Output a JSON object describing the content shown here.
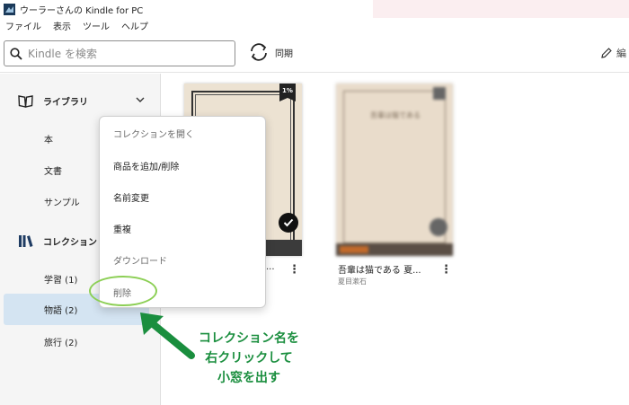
{
  "window": {
    "title": "ウーラーさんの Kindle for PC"
  },
  "menu": [
    "ファイル",
    "表示",
    "ツール",
    "ヘルプ"
  ],
  "toolbar": {
    "search_placeholder": "Kindle を検索",
    "sync_label": "同期",
    "edit_label": "編"
  },
  "sidebar": {
    "library": "ライブラリ",
    "library_items": [
      "本",
      "文書",
      "サンプル"
    ],
    "collections": "コレクション",
    "collection_items": [
      "学習 (1)",
      "物語 (2)",
      "旅行 (2)"
    ],
    "selected_collection": "物語 (2)"
  },
  "books": [
    {
      "title": "...",
      "author": "",
      "progress_badge": "1%",
      "selected": true
    },
    {
      "title": "吾輩は猫である 夏...",
      "author": "夏目漱石",
      "cover_text": "吾輩は猫である",
      "selected": false
    }
  ],
  "context_menu": [
    "コレクションを開く",
    "商品を追加/削除",
    "名前変更",
    "重複",
    "ダウンロード",
    "削除"
  ],
  "annotation": {
    "lines": [
      "コレクション名を",
      "右クリックして",
      "小窓を出す"
    ],
    "color": "#1a8e3e"
  },
  "colors": {
    "selected_bg": "#d4e4f2",
    "highlight_circle": "#8ccf55",
    "sidebar_bg": "#f5f5f5"
  }
}
